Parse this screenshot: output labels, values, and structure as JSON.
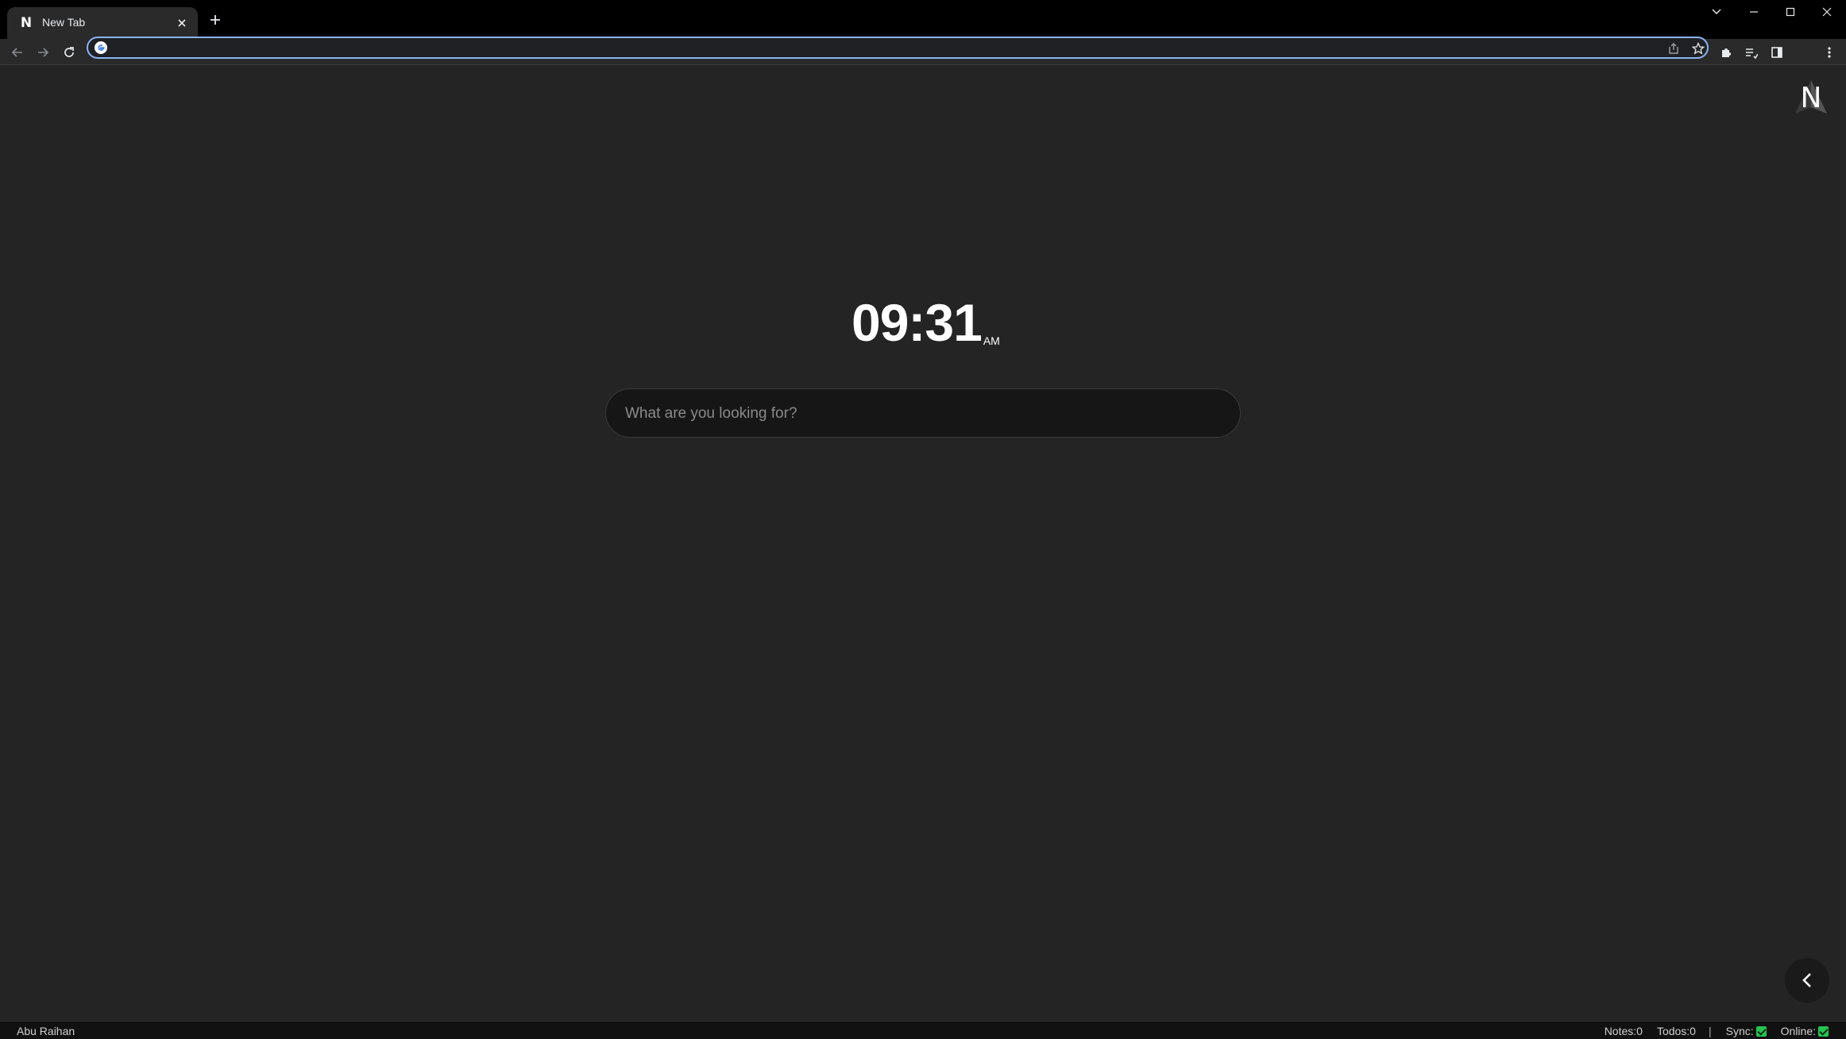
{
  "browser": {
    "tab": {
      "title": "New Tab",
      "favicon": "N"
    },
    "icons": {
      "back": "arrow-left-icon",
      "forward": "arrow-right-icon",
      "reload": "reload-icon",
      "share": "share-icon",
      "bookmark": "star-icon",
      "extensions": "puzzle-icon",
      "reading_list": "reading-list-icon",
      "side_panel": "side-panel-icon",
      "menu": "kebab-menu-icon"
    },
    "address": {
      "value": "",
      "placeholder": ""
    },
    "accent_color": "#8ab4f8"
  },
  "page": {
    "logo_letter": "N",
    "clock": {
      "time": "09:31",
      "period": "AM"
    },
    "search": {
      "placeholder": "What are you looking for?"
    }
  },
  "statusbar": {
    "user": "Abu Raihan",
    "notes": "Notes:0",
    "todos": "Todos:0",
    "separator": "|",
    "sync": "Sync:",
    "online": "Online:",
    "ok_color": "#23c552"
  }
}
